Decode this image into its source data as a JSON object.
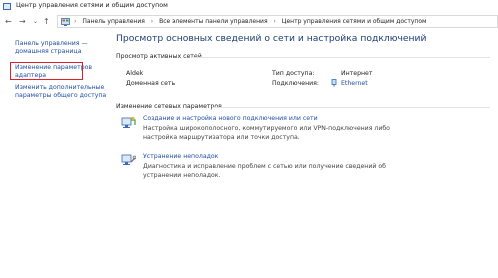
{
  "window": {
    "title": "Центр управления сетями и общим доступом"
  },
  "nav": {
    "back": "←",
    "forward": "→",
    "dropdown": "⌄",
    "up": "↑"
  },
  "breadcrumb": [
    "Панель управления",
    "Все элементы панели управления",
    "Центр управления сетями и общим доступом"
  ],
  "breadcrumb_sep": "›",
  "sidebar": {
    "home_line1": "Панель управления —",
    "home_line2": "домашняя страница",
    "adapter_line1": "Изменение параметров",
    "adapter_line2": "адаптера",
    "sharing_line1": "Изменить дополнительные",
    "sharing_line2": "параметры общего доступа"
  },
  "main": {
    "title": "Просмотр основных сведений о сети и настройка подключений",
    "active_header": "Просмотр активных сетей",
    "network_name": "Aldek",
    "network_type": "Доменная сеть",
    "access_label": "Тип доступа:",
    "access_value": "Интернет",
    "connections_label": "Подключения:",
    "connections_value": "Ethernet",
    "change_header": "Изменение сетевых параметров",
    "item1_link": "Создание и настройка нового подключения или сети",
    "item1_desc": "Настройка широкополосного, коммутируемого или VPN-подключения либо настройка маршрутизатора или точки доступа.",
    "item2_link": "Устранение неполадок",
    "item2_desc": "Диагностика и исправление проблем с сетью или получение сведений об устранении неполадок."
  },
  "colors": {
    "link": "#1f4ea3",
    "title": "#1e3c78",
    "highlight": "#e3202a"
  }
}
